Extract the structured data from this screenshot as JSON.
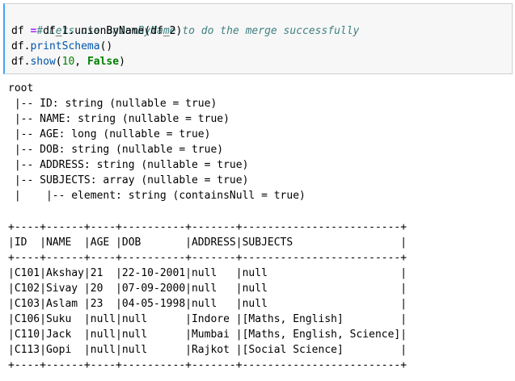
{
  "cell": {
    "comment": "# Lets use unionByName to do the merge successfully",
    "line1": {
      "lhs": "df ",
      "op": "=",
      "rhs": " df_1.unionByName(df_2)"
    },
    "line2": {
      "obj": "df.",
      "method": "printSchema",
      "rest": "()"
    },
    "line3": {
      "obj": "df.",
      "method": "show",
      "open": "(",
      "num": "10",
      "sep": ", ",
      "kw": "False",
      "close": ")"
    }
  },
  "output": {
    "schema": [
      "root",
      " |-- ID: string (nullable = true)",
      " |-- NAME: string (nullable = true)",
      " |-- AGE: long (nullable = true)",
      " |-- DOB: string (nullable = true)",
      " |-- ADDRESS: string (nullable = true)",
      " |-- SUBJECTS: array (nullable = true)",
      " |    |-- element: string (containsNull = true)"
    ],
    "table": [
      "+----+------+----+----------+-------+-------------------------+",
      "|ID  |NAME  |AGE |DOB       |ADDRESS|SUBJECTS                 |",
      "+----+------+----+----------+-------+-------------------------+",
      "|C101|Akshay|21  |22-10-2001|null   |null                     |",
      "|C102|Sivay |20  |07-09-2000|null   |null                     |",
      "|C103|Aslam |23  |04-05-1998|null   |null                     |",
      "|C106|Suku  |null|null      |Indore |[Maths, English]         |",
      "|C110|Jack  |null|null      |Mumbai |[Maths, English, Science]|",
      "|C113|Gopi  |null|null      |Rajkot |[Social Science]         |",
      "+----+------+----+----------+-------+-------------------------+"
    ]
  }
}
